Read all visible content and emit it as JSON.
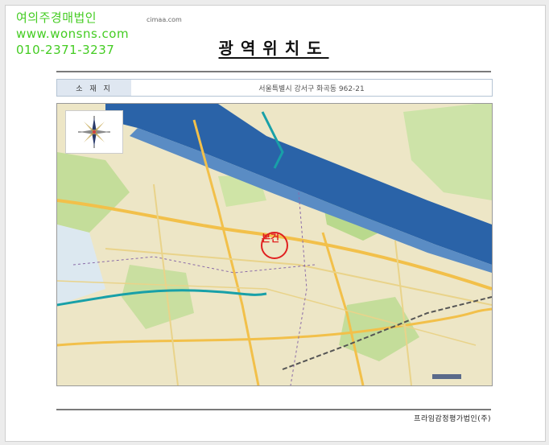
{
  "watermark": {
    "name": "여의주경매법인",
    "website": "www.wonsns.com",
    "phone": "010-2371-3237"
  },
  "document": {
    "header_url": "cimaa.com",
    "title": "광역위치도",
    "address_label": "소 재 지",
    "address_value": "서울특별시 강서구 화곡동 962-21",
    "footer": "프라임감정평가법인(주)"
  },
  "map": {
    "marker_label": "본건",
    "compass_label": "N",
    "colors": {
      "river": "#2a63a8",
      "land": "#ede6c6",
      "park": "#b9d98d",
      "road_major": "#f2c04a",
      "marker": "#e02020",
      "subway_line": "#18a0a8"
    },
    "icons": [
      "compass-icon",
      "location-marker-icon"
    ]
  }
}
